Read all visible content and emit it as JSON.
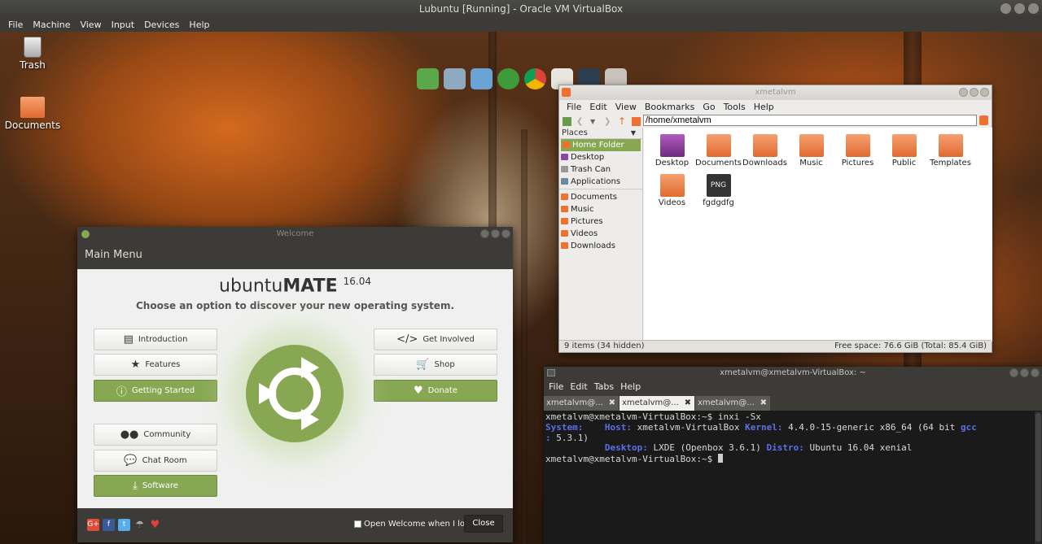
{
  "window": {
    "title": "Lubuntu [Running] - Oracle VM VirtualBox"
  },
  "host_menu": [
    "File",
    "Machine",
    "View",
    "Input",
    "Devices",
    "Help"
  ],
  "desktop": {
    "icons": [
      {
        "label": "Trash"
      },
      {
        "label": "Documents"
      }
    ],
    "dock": [
      "writer-icon",
      "mail-icon",
      "media-icon",
      "update-icon",
      "chrome-icon",
      "teacup-icon",
      "monitor-icon",
      "archive-icon"
    ]
  },
  "file_manager": {
    "title": "xmetalvm",
    "menu": [
      "File",
      "Edit",
      "View",
      "Bookmarks",
      "Go",
      "Tools",
      "Help"
    ],
    "path": "/home/xmetalvm",
    "places_label": "Places",
    "places": [
      {
        "label": "Home Folder",
        "color": "#f07030"
      },
      {
        "label": "Desktop",
        "color": "#8e44ad"
      },
      {
        "label": "Trash Can",
        "color": "#999999"
      },
      {
        "label": "Applications",
        "color": "#6b8aa0"
      }
    ],
    "bookmarks": [
      {
        "label": "Documents",
        "color": "#f07030"
      },
      {
        "label": "Music",
        "color": "#f07030"
      },
      {
        "label": "Pictures",
        "color": "#f07030"
      },
      {
        "label": "Videos",
        "color": "#f07030"
      },
      {
        "label": "Downloads",
        "color": "#f07030"
      }
    ],
    "items": [
      {
        "label": "Desktop",
        "color": "#8e3a9d"
      },
      {
        "label": "Documents",
        "color": "#f28850"
      },
      {
        "label": "Downloads",
        "color": "#f28850"
      },
      {
        "label": "Music",
        "color": "#f28850"
      },
      {
        "label": "Pictures",
        "color": "#f28850"
      },
      {
        "label": "Public",
        "color": "#f28850"
      },
      {
        "label": "Templates",
        "color": "#f28850"
      },
      {
        "label": "Videos",
        "color": "#f28850"
      },
      {
        "label": "fgdgdfg",
        "color": "#333333",
        "badge": "PNG"
      }
    ],
    "status_left": "9 items (34 hidden)",
    "status_right": "Free space: 76.6 GiB (Total: 85.4 GiB)"
  },
  "welcome": {
    "title": "Welcome",
    "header": "Main Menu",
    "logo_light": "ubuntu",
    "logo_bold": "MATE",
    "version": "16.04",
    "subtitle": "Choose an option to discover your new operating system.",
    "buttons": {
      "introduction": "Introduction",
      "features": "Features",
      "getting_started": "Getting Started",
      "community": "Community",
      "chat_room": "Chat Room",
      "software": "Software",
      "get_involved": "Get Involved",
      "shop": "Shop",
      "donate": "Donate"
    },
    "checkbox_label": "Open Welcome when I log on.",
    "close": "Close",
    "social": [
      "G+",
      "f",
      "t"
    ]
  },
  "terminal": {
    "title": "xmetalvm@xmetalvm-VirtualBox: ~",
    "menu": [
      "File",
      "Edit",
      "Tabs",
      "Help"
    ],
    "tabs": [
      "xmetalvm@...",
      "xmetalvm@...",
      "xmetalvm@..."
    ],
    "tab_close": "✖",
    "prompt": "xmetalvm@xmetalvm-VirtualBox:~$ ",
    "command": "inxi -Sx",
    "system_label": "System:",
    "host_label": "Host:",
    "host": "xmetalvm-VirtualBox",
    "kernel_label": "Kernel:",
    "kernel": "4.4.0-15-generic x86_64 (64 bit",
    "gcc_label": "gcc",
    "gcc": "5.3.1)",
    "desktop_label": "Desktop:",
    "desktop": "LXDE (Openbox 3.6.1)",
    "distro_label": "Distro:",
    "distro": "Ubuntu 16.04 xenial"
  }
}
